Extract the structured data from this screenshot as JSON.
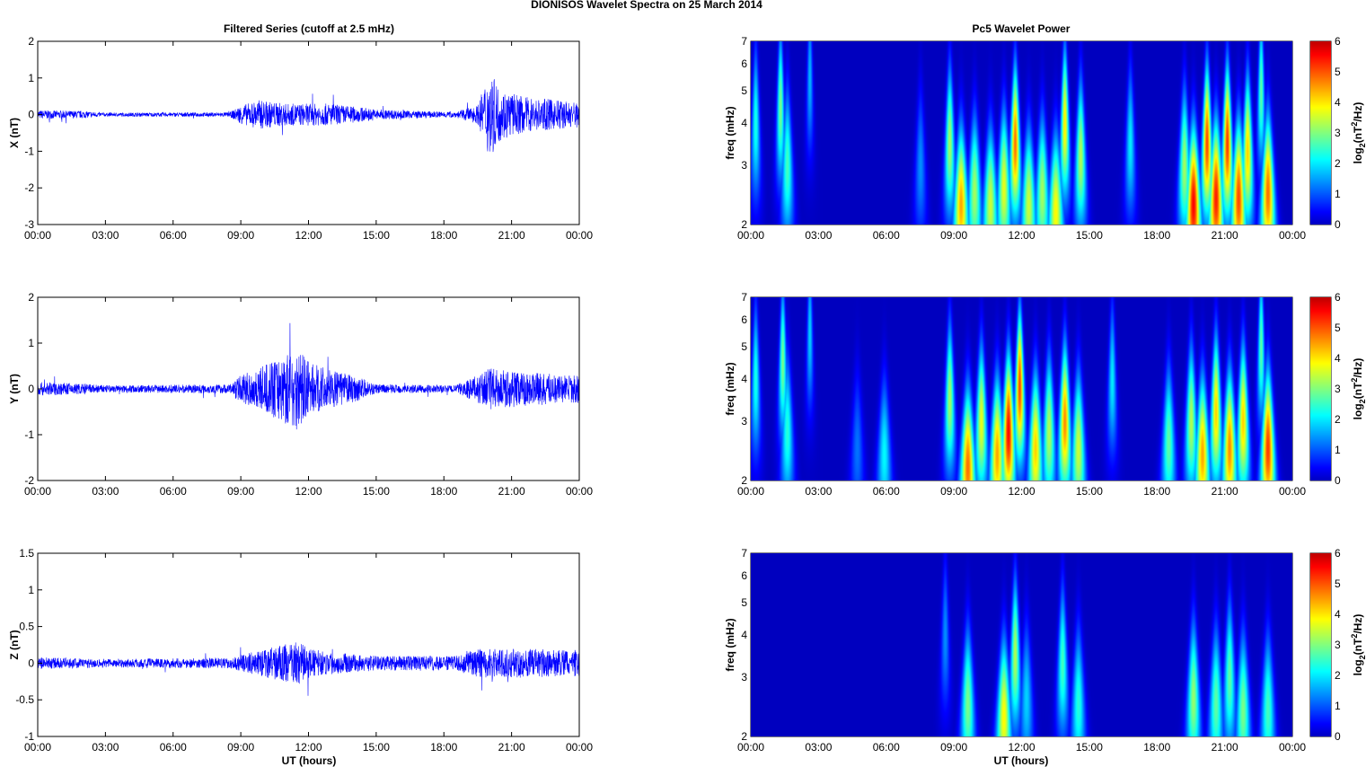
{
  "title": "DIONISOS Wavelet Spectra on 25 March     2014",
  "left_title": "Filtered Series (cutoff at 2.5 mHz)",
  "right_title": "Pc5 Wavelet Power",
  "xlabel": "UT (hours)",
  "chart_data": [
    {
      "type": "line",
      "ylabel": "X (nT)",
      "ylim": [
        -3,
        2
      ],
      "yticks": [
        "2",
        "1",
        "0",
        "-1",
        "-2",
        "-3"
      ],
      "ytick_values": [
        2,
        1,
        0,
        -1,
        -2,
        -3
      ],
      "activity": [
        [
          0,
          0.12
        ],
        [
          2,
          0.1
        ],
        [
          3,
          0.05
        ],
        [
          8.5,
          0.06
        ],
        [
          9,
          0.25
        ],
        [
          9.8,
          0.4
        ],
        [
          11,
          0.3
        ],
        [
          13,
          0.3
        ],
        [
          15,
          0.15
        ],
        [
          16.5,
          0.1
        ],
        [
          18.5,
          0.08
        ],
        [
          19.5,
          0.25
        ],
        [
          20,
          1.2
        ],
        [
          20.5,
          0.7
        ],
        [
          21.5,
          0.5
        ],
        [
          23,
          0.4
        ],
        [
          24,
          0.35
        ]
      ]
    },
    {
      "type": "line",
      "ylabel": "Y (nT)",
      "ylim": [
        -2,
        2
      ],
      "yticks": [
        "2",
        "1",
        "0",
        "-1",
        "-2"
      ],
      "ytick_values": [
        2,
        1,
        0,
        -1,
        -2
      ],
      "activity": [
        [
          0,
          0.15
        ],
        [
          2,
          0.12
        ],
        [
          3,
          0.08
        ],
        [
          8.5,
          0.1
        ],
        [
          9,
          0.3
        ],
        [
          10,
          0.5
        ],
        [
          11.5,
          0.9
        ],
        [
          12,
          0.6
        ],
        [
          13,
          0.4
        ],
        [
          14,
          0.3
        ],
        [
          15,
          0.1
        ],
        [
          18.5,
          0.08
        ],
        [
          19.5,
          0.3
        ],
        [
          20,
          0.45
        ],
        [
          22,
          0.35
        ],
        [
          24,
          0.3
        ]
      ]
    },
    {
      "type": "line",
      "ylabel": "Z (nT)",
      "ylim": [
        -1,
        1.5
      ],
      "yticks": [
        "1.5",
        "1",
        "0.5",
        "0",
        "-0.5",
        "-1"
      ],
      "ytick_values": [
        1.5,
        1,
        0.5,
        0,
        -0.5,
        -1
      ],
      "activity": [
        [
          0,
          0.08
        ],
        [
          3,
          0.06
        ],
        [
          8.5,
          0.07
        ],
        [
          9.5,
          0.15
        ],
        [
          11.5,
          0.3
        ],
        [
          12,
          0.2
        ],
        [
          13,
          0.15
        ],
        [
          15,
          0.1
        ],
        [
          18.5,
          0.1
        ],
        [
          19.5,
          0.2
        ],
        [
          21,
          0.2
        ],
        [
          24,
          0.18
        ]
      ]
    },
    {
      "type": "heatmap",
      "ylabel": "freq (mHz)",
      "ylim": [
        2,
        7
      ],
      "yticks": [
        "2",
        "3",
        "4",
        "5",
        "6",
        "7"
      ],
      "ytick_values": [
        2,
        3,
        4,
        5,
        6,
        7
      ],
      "clim": [
        0,
        6
      ],
      "cbar_ticks": [
        "0",
        "1",
        "2",
        "3",
        "4",
        "5",
        "6"
      ],
      "cbar_label": "log2(nT2/Hz)",
      "events": [
        [
          0.2,
          4,
          2.5
        ],
        [
          1.3,
          4.5,
          3.2
        ],
        [
          1.6,
          3,
          2.8
        ],
        [
          2.6,
          5.5,
          1.8
        ],
        [
          7.5,
          3,
          1.5
        ],
        [
          8.8,
          3.5,
          3.5
        ],
        [
          9.3,
          2.3,
          4.8
        ],
        [
          9.9,
          2.5,
          3.5
        ],
        [
          10.6,
          2.3,
          3.8
        ],
        [
          11.2,
          2.6,
          4
        ],
        [
          11.7,
          3.5,
          5.2
        ],
        [
          12.3,
          2.3,
          3.8
        ],
        [
          12.9,
          2.5,
          3.5
        ],
        [
          13.5,
          2.2,
          4.2
        ],
        [
          13.9,
          4,
          4.3
        ],
        [
          14.6,
          3.2,
          3.6
        ],
        [
          16.8,
          3.5,
          2.2
        ],
        [
          19.2,
          3,
          3.5
        ],
        [
          19.6,
          2.3,
          6
        ],
        [
          20.2,
          3.5,
          5.5
        ],
        [
          20.6,
          2.4,
          5.8
        ],
        [
          21.1,
          3.5,
          5.6
        ],
        [
          21.6,
          2.4,
          5.5
        ],
        [
          22,
          3.3,
          4.5
        ],
        [
          22.9,
          2.5,
          5.2
        ],
        [
          22.6,
          5,
          3
        ]
      ]
    },
    {
      "type": "heatmap",
      "ylabel": "freq (mHz)",
      "ylim": [
        2,
        7
      ],
      "yticks": [
        "2",
        "3",
        "4",
        "5",
        "6",
        "7"
      ],
      "ytick_values": [
        2,
        3,
        4,
        5,
        6,
        7
      ],
      "clim": [
        0,
        6
      ],
      "cbar_ticks": [
        "0",
        "1",
        "2",
        "3",
        "4",
        "5",
        "6"
      ],
      "cbar_label": "log2(nT2/Hz)",
      "events": [
        [
          0.2,
          4,
          2.5
        ],
        [
          1.4,
          4.5,
          3.2
        ],
        [
          1.6,
          2.8,
          2.6
        ],
        [
          2.6,
          5.5,
          2
        ],
        [
          4.7,
          2.5,
          1.3
        ],
        [
          5.9,
          2.4,
          2.3
        ],
        [
          8.8,
          3.5,
          3.5
        ],
        [
          9.6,
          2.2,
          5.2
        ],
        [
          10.2,
          3,
          4
        ],
        [
          10.9,
          2.4,
          4.8
        ],
        [
          11.4,
          2.8,
          6
        ],
        [
          11.9,
          3.8,
          5.5
        ],
        [
          12.6,
          2.5,
          4.5
        ],
        [
          13.2,
          2.8,
          3.6
        ],
        [
          13.9,
          3,
          5
        ],
        [
          14.5,
          2.5,
          3.8
        ],
        [
          16,
          4,
          2.2
        ],
        [
          18.5,
          2.6,
          3
        ],
        [
          19.5,
          3,
          3.6
        ],
        [
          20,
          2.4,
          4.8
        ],
        [
          20.6,
          3.2,
          4.5
        ],
        [
          21.2,
          2.5,
          5
        ],
        [
          21.8,
          3,
          4.5
        ],
        [
          22.9,
          2.5,
          5.6
        ],
        [
          22.6,
          5,
          3
        ]
      ]
    },
    {
      "type": "heatmap",
      "ylabel": "freq (mHz)",
      "ylim": [
        2,
        7
      ],
      "yticks": [
        "2",
        "3",
        "4",
        "5",
        "6",
        "7"
      ],
      "ytick_values": [
        2,
        3,
        4,
        5,
        6,
        7
      ],
      "clim": [
        0,
        6
      ],
      "cbar_ticks": [
        "0",
        "1",
        "2",
        "3",
        "4",
        "5",
        "6"
      ],
      "cbar_label": "log2(nT2/Hz)",
      "events": [
        [
          8.6,
          4,
          1.5
        ],
        [
          9.6,
          2.5,
          3.2
        ],
        [
          11.2,
          2.3,
          4.2
        ],
        [
          11.7,
          3.5,
          3.6
        ],
        [
          12.2,
          2.6,
          2
        ],
        [
          13.8,
          3.3,
          2.8
        ],
        [
          14.5,
          2.5,
          2.6
        ],
        [
          19.6,
          2.6,
          3.4
        ],
        [
          20.6,
          2.5,
          3
        ],
        [
          21.2,
          3,
          3
        ],
        [
          21.8,
          2.4,
          3.2
        ],
        [
          22.9,
          2.4,
          2.8
        ]
      ]
    }
  ],
  "xticks": [
    "00:00",
    "03:00",
    "06:00",
    "09:00",
    "12:00",
    "15:00",
    "18:00",
    "21:00",
    "00:00"
  ]
}
